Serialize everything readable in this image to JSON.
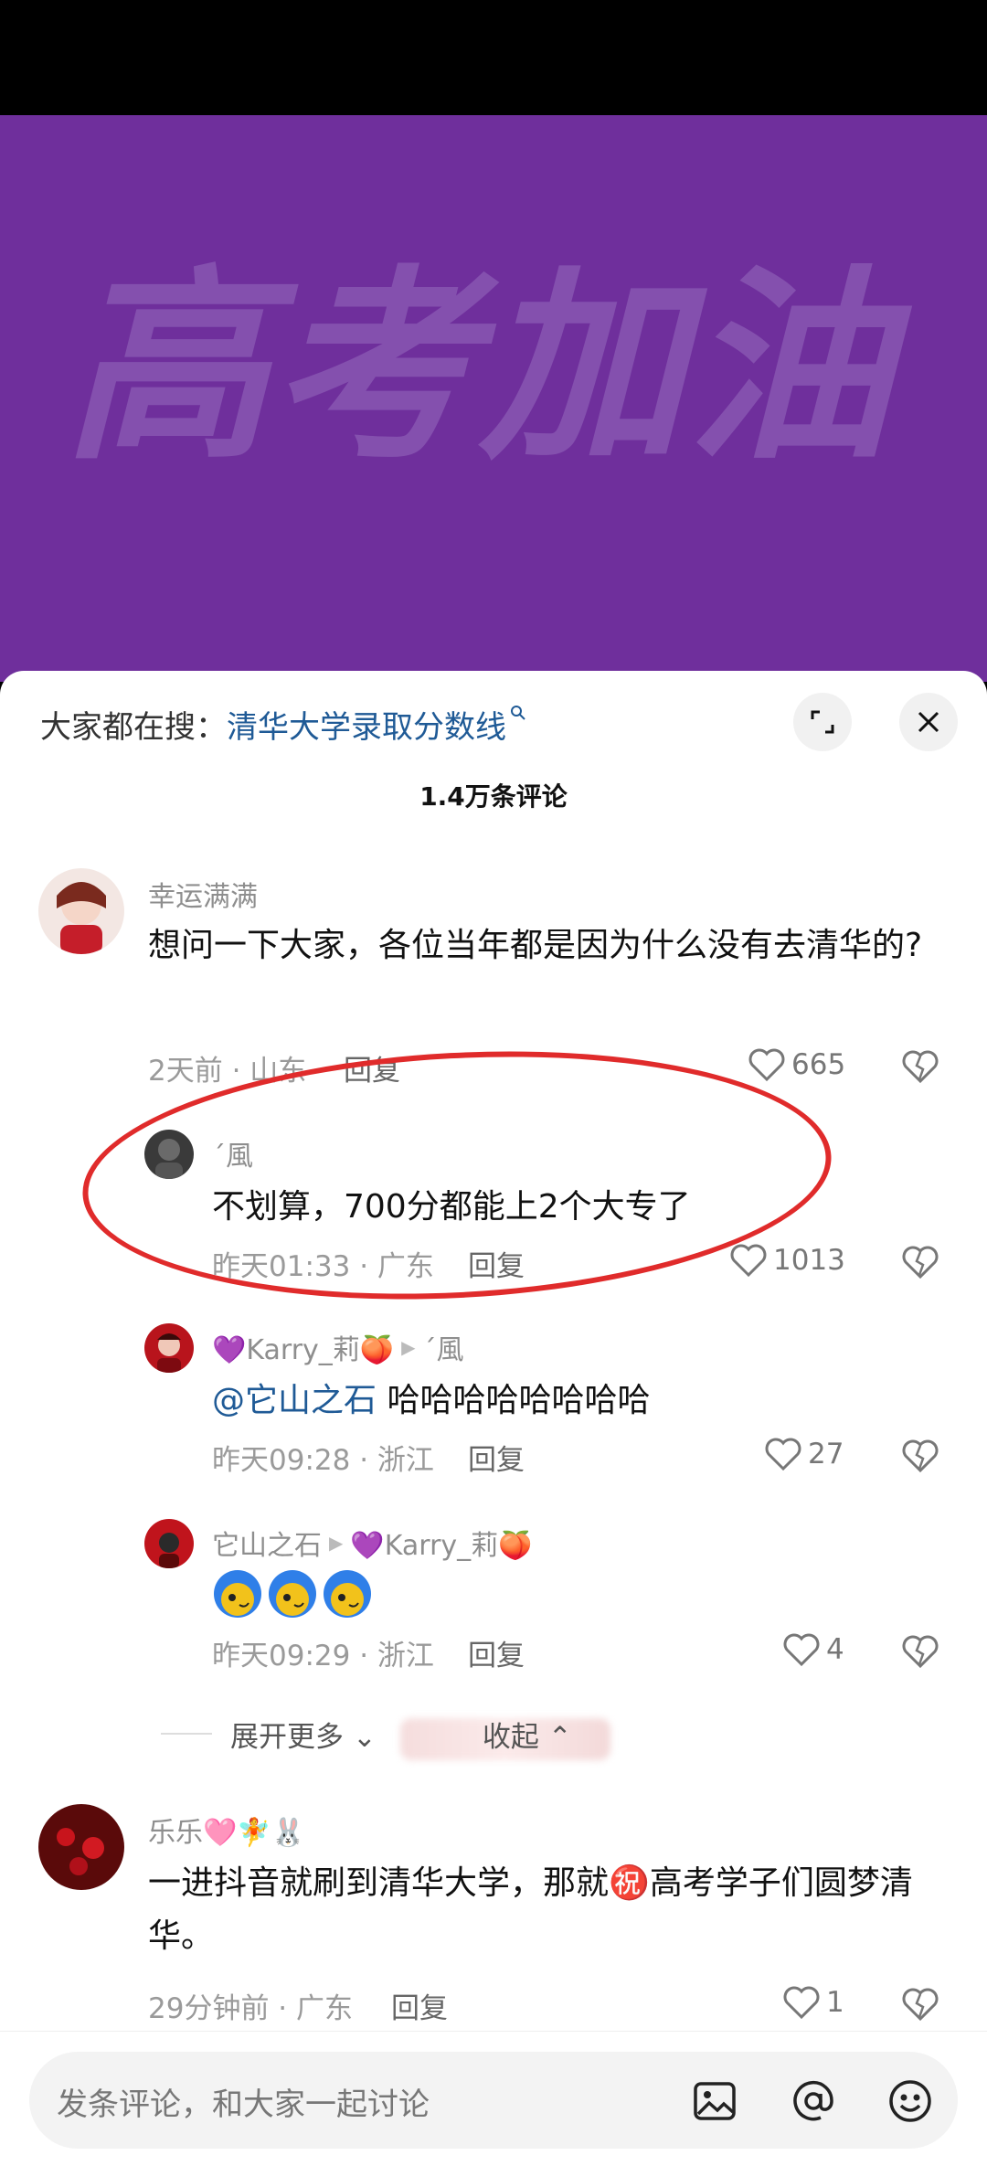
{
  "banner": {
    "title": "高考加油"
  },
  "search": {
    "prefix": "大家都在搜：",
    "query": "清华大学录取分数线"
  },
  "comments_count": "1.4万条评论",
  "comments": [
    {
      "user": "幸运满满",
      "text": "想问一下大家，各位当年都是因为什么没有去清华的?",
      "time_location": "2天前 · 山东",
      "reply_label": "回复",
      "likes": "665"
    },
    {
      "user": "´風",
      "text": "不划算，700分都能上2个大专了",
      "time_location": "昨天01:33 · 广东",
      "reply_label": "回复",
      "likes": "1013"
    },
    {
      "user": "💜Karry_莉🍑",
      "reply_to": "´風",
      "mention": "@它山之石",
      "text": " 哈哈哈哈哈哈哈哈",
      "time_location": "昨天09:28 · 浙江",
      "reply_label": "回复",
      "likes": "27"
    },
    {
      "user": "它山之石",
      "reply_to": "💜Karry_莉🍑",
      "text": "",
      "time_location": "昨天09:29 · 浙江",
      "reply_label": "回复",
      "likes": "4"
    },
    {
      "user": "乐乐🩷🧚🐰",
      "text": "一进抖音就刷到清华大学，那就㊗️高考学子们圆梦清华。",
      "time_location": "29分钟前 · 广东",
      "reply_label": "回复",
      "likes": "1"
    }
  ],
  "expand": {
    "more": "展开更多",
    "collapse": "收起"
  },
  "input": {
    "placeholder": "发条评论，和大家一起讨论"
  },
  "colors": {
    "banner_bg": "#6f2f9c",
    "link": "#1f5a96",
    "annotation": "#e02b2b"
  }
}
